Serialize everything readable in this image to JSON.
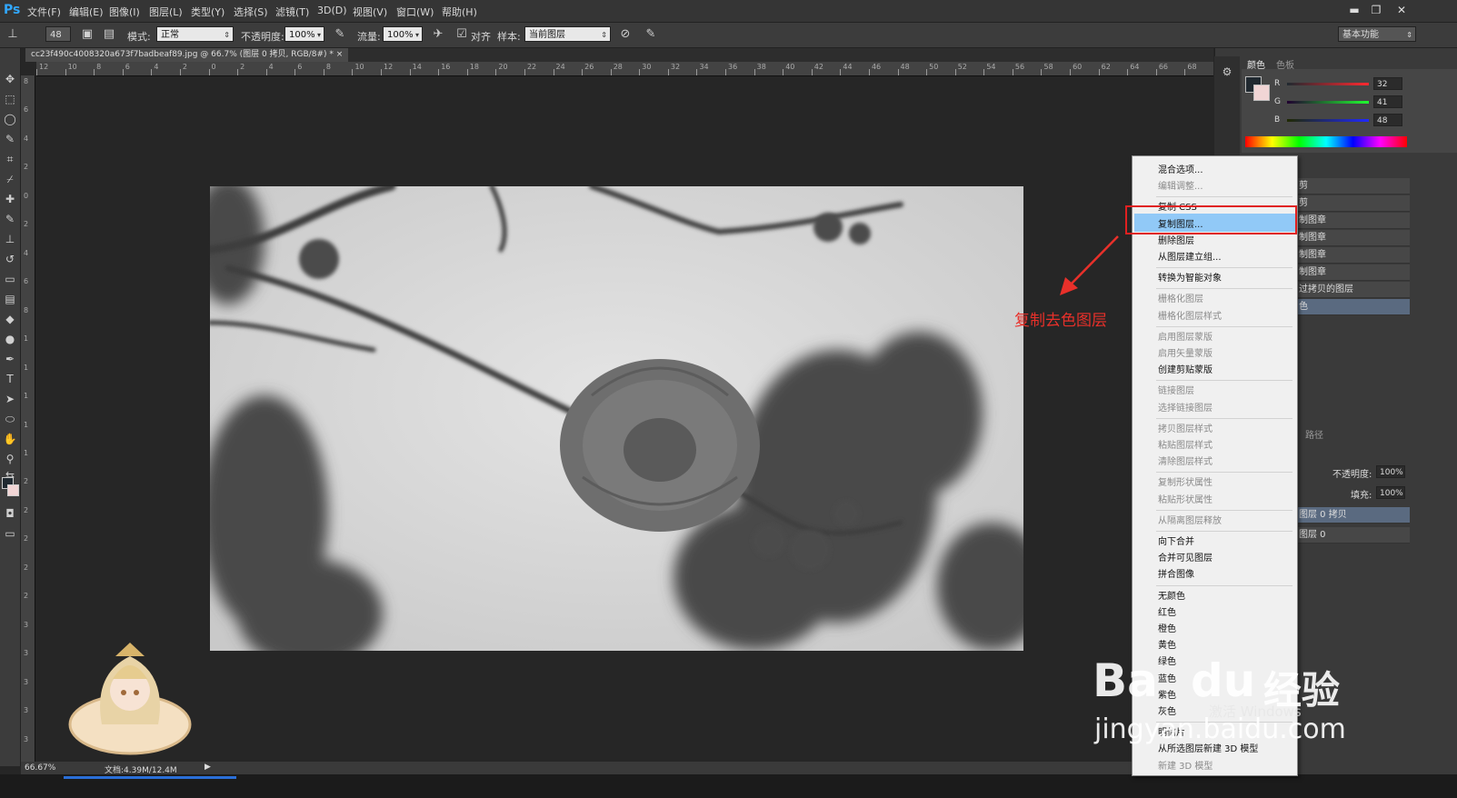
{
  "app": {
    "logo": "Ps"
  },
  "menubar": {
    "items": [
      "文件(F)",
      "编辑(E)",
      "图像(I)",
      "图层(L)",
      "类型(Y)",
      "选择(S)",
      "滤镜(T)",
      "3D(D)",
      "视图(V)",
      "窗口(W)",
      "帮助(H)"
    ]
  },
  "window_controls": {
    "minimize": "▬",
    "restore": "❐",
    "close": "✕"
  },
  "options": {
    "brush_size": "48",
    "mode_label": "模式:",
    "mode_value": "正常",
    "opacity_label": "不透明度:",
    "opacity_value": "100%",
    "flow_label": "流量:",
    "flow_value": "100%",
    "align_label": "对齐",
    "sample_label": "样本:",
    "sample_value": "当前图层",
    "workspace": "基本功能"
  },
  "document": {
    "tab_title": "cc23f490c4008320a673f7badbeaf89.jpg @ 66.7% (图层 0 拷贝, RGB/8#) *",
    "tab_close": "×"
  },
  "ruler": {
    "h": [
      "12",
      "10",
      "8",
      "6",
      "4",
      "2",
      "0",
      "2",
      "4",
      "6",
      "8",
      "10",
      "12",
      "14",
      "16",
      "18",
      "20",
      "22",
      "24",
      "26",
      "28",
      "30",
      "32",
      "34",
      "36",
      "38",
      "40",
      "42",
      "44",
      "46",
      "48",
      "50",
      "52",
      "54",
      "56",
      "58",
      "60",
      "62",
      "64",
      "66",
      "68"
    ],
    "v": [
      "8",
      "6",
      "4",
      "2",
      "0",
      "2",
      "4",
      "6",
      "8",
      "1",
      "1",
      "1",
      "1",
      "1",
      "2",
      "2",
      "2",
      "2",
      "2",
      "3",
      "3",
      "3",
      "3",
      "3"
    ]
  },
  "status": {
    "zoom": "66.67%",
    "doc": "文档:4.39M/12.4M"
  },
  "color_panel": {
    "tab_color": "颜色",
    "tab_swatches": "色板",
    "r_label": "R",
    "g_label": "G",
    "b_label": "B",
    "r": "32",
    "g": "41",
    "b": "48"
  },
  "history_rows": [
    "剪",
    "剪",
    "制图章",
    "制图章",
    "制图章",
    "制图章",
    "过拷贝的图层",
    "色"
  ],
  "paths_tab": "路径",
  "layers": {
    "opacity_label": "不透明度:",
    "opacity": "100%",
    "fill_label": "填充:",
    "fill": "100%",
    "rows": [
      "图层 0 拷贝",
      "图层 0"
    ]
  },
  "context_menu": {
    "groups": [
      [
        {
          "label": "混合选项...",
          "enabled": true
        },
        {
          "label": "编辑调整...",
          "enabled": false
        }
      ],
      [
        {
          "label": "复制 CSS",
          "enabled": true
        },
        {
          "label": "复制图层...",
          "enabled": true,
          "highlighted": true
        },
        {
          "label": "删除图层",
          "enabled": true
        },
        {
          "label": "从图层建立组...",
          "enabled": true
        }
      ],
      [
        {
          "label": "转换为智能对象",
          "enabled": true
        }
      ],
      [
        {
          "label": "栅格化图层",
          "enabled": false
        },
        {
          "label": "栅格化图层样式",
          "enabled": false
        }
      ],
      [
        {
          "label": "启用图层蒙版",
          "enabled": false
        },
        {
          "label": "启用矢量蒙版",
          "enabled": false
        },
        {
          "label": "创建剪贴蒙版",
          "enabled": true
        }
      ],
      [
        {
          "label": "链接图层",
          "enabled": false
        },
        {
          "label": "选择链接图层",
          "enabled": false
        }
      ],
      [
        {
          "label": "拷贝图层样式",
          "enabled": false
        },
        {
          "label": "粘贴图层样式",
          "enabled": false
        },
        {
          "label": "清除图层样式",
          "enabled": false
        }
      ],
      [
        {
          "label": "复制形状属性",
          "enabled": false
        },
        {
          "label": "粘贴形状属性",
          "enabled": false
        }
      ],
      [
        {
          "label": "从隔离图层释放",
          "enabled": false
        }
      ],
      [
        {
          "label": "向下合并",
          "enabled": true
        },
        {
          "label": "合并可见图层",
          "enabled": true
        },
        {
          "label": "拼合图像",
          "enabled": true
        }
      ],
      [
        {
          "label": "无颜色",
          "enabled": true
        },
        {
          "label": "红色",
          "enabled": true
        },
        {
          "label": "橙色",
          "enabled": true
        },
        {
          "label": "黄色",
          "enabled": true
        },
        {
          "label": "绿色",
          "enabled": true
        },
        {
          "label": "蓝色",
          "enabled": true
        },
        {
          "label": "紫色",
          "enabled": true
        },
        {
          "label": "灰色",
          "enabled": true
        }
      ],
      [
        {
          "label": "明信片",
          "enabled": true
        },
        {
          "label": "从所选图层新建 3D 模型",
          "enabled": true
        },
        {
          "label": "新建 3D 模型",
          "enabled": false
        }
      ]
    ]
  },
  "annotation": {
    "text": "复制去色图层",
    "color": "#e8302a"
  },
  "watermark": {
    "brand_a": "Ba",
    "brand_b": "du",
    "brand_cn": "经验",
    "url": "jingyan.baidu.com",
    "windows": "激活 Windows"
  },
  "colors": {
    "accent": "#31a8ff",
    "highlight": "#91c9f7",
    "annotation": "#e8302a"
  }
}
